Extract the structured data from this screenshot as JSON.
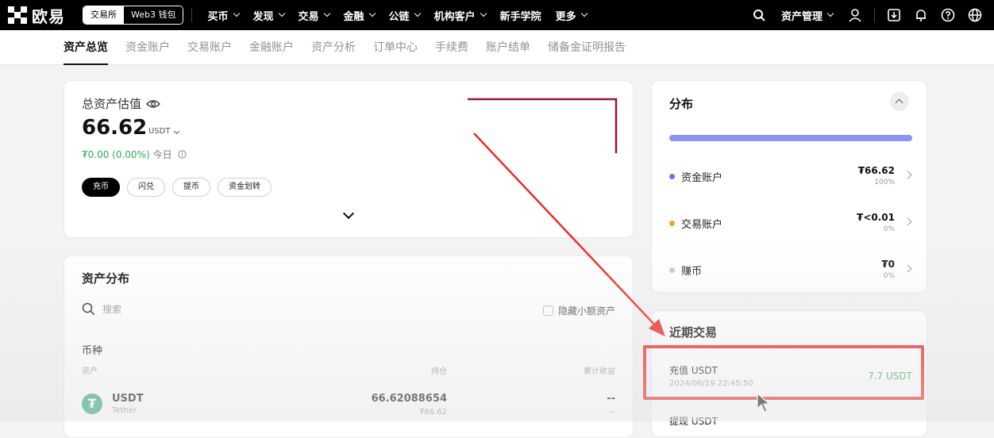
{
  "topbar": {
    "logo_text": "欧易",
    "segment": {
      "exchange": "交易所",
      "web3": "Web3 钱包"
    },
    "nav": [
      "买币",
      "发现",
      "交易",
      "金融",
      "公链",
      "机构客户",
      "新手学院",
      "更多"
    ],
    "asset_mgmt": "资产管理",
    "icons": [
      "search-icon",
      "user-icon",
      "download-icon",
      "bell-icon",
      "help-icon",
      "globe-icon"
    ]
  },
  "subnav": {
    "tabs": [
      "资产总览",
      "资金账户",
      "交易账户",
      "金融账户",
      "资产分析",
      "订单中心",
      "手续费",
      "账户结单",
      "储备金证明报告"
    ],
    "active": 0
  },
  "overview": {
    "label": "总资产估值",
    "value": "66.62",
    "currency": "USDT",
    "change": "₮0.00 (0.00%)",
    "today": "今日",
    "buttons": [
      "充币",
      "闪兑",
      "提币",
      "资金划转"
    ]
  },
  "distribution": {
    "title": "资产分布",
    "search_placeholder": "搜索",
    "hide_small": "隐藏小额资产",
    "section": "币种",
    "columns": {
      "asset": "资产",
      "holding": "持仓",
      "pnl": "累计收益"
    },
    "rows": [
      {
        "symbol": "USDT",
        "name": "Tether",
        "amount": "66.62088654",
        "value": "₮66.62",
        "pnl": "--",
        "pnl_sub": "--"
      }
    ]
  },
  "allocation": {
    "title": "分布",
    "accounts": [
      {
        "name": "资金账户",
        "amount": "₮66.62",
        "pct": "100%",
        "color": "#6b74ef"
      },
      {
        "name": "交易账户",
        "amount": "₮<0.01",
        "pct": "0%",
        "color": "#f0a41a"
      },
      {
        "name": "赚币",
        "amount": "₮0",
        "pct": "0%",
        "color": "#c9c9c9"
      }
    ]
  },
  "recent": {
    "title": "近期交易",
    "items": [
      {
        "title": "充值 USDT",
        "time": "2024/06/19 22:45:50",
        "amount": "7.7 USDT"
      },
      {
        "title": "提现 USDT"
      }
    ]
  },
  "colors": {
    "positive": "#2eac5c",
    "annotation": "#ee2a24",
    "brand_bg": "#000000"
  }
}
